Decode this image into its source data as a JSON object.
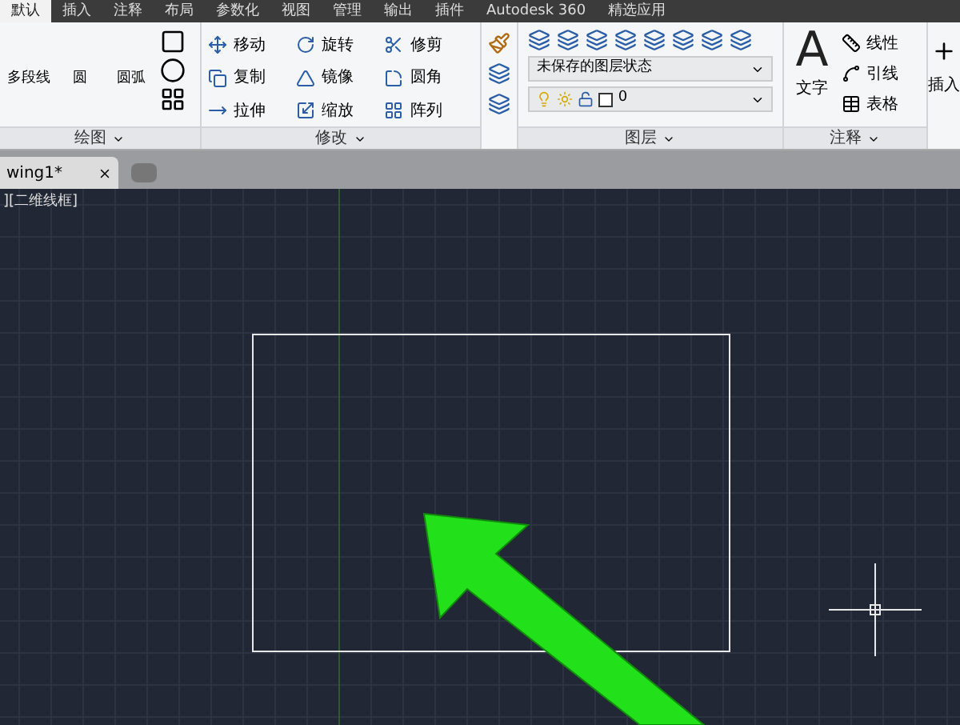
{
  "ribbon_tabs": [
    {
      "label": "默认",
      "selected": true
    },
    {
      "label": "插入",
      "selected": false
    },
    {
      "label": "注释",
      "selected": false
    },
    {
      "label": "布局",
      "selected": false
    },
    {
      "label": "参数化",
      "selected": false
    },
    {
      "label": "视图",
      "selected": false
    },
    {
      "label": "管理",
      "selected": false
    },
    {
      "label": "输出",
      "selected": false
    },
    {
      "label": "插件",
      "selected": false
    },
    {
      "label": "Autodesk 360",
      "selected": false
    },
    {
      "label": "精选应用",
      "selected": false
    }
  ],
  "panels": {
    "draw": {
      "title": "绘图",
      "tools": [
        "多段线",
        "圆",
        "圆弧"
      ]
    },
    "modify": {
      "title": "修改",
      "tools": [
        "移动",
        "旋转",
        "修剪",
        "复制",
        "镜像",
        "圆角",
        "拉伸",
        "缩放",
        "阵列"
      ]
    },
    "layers": {
      "title": "图层",
      "state": "未保存的图层状态",
      "current_layer": "0"
    },
    "annotation": {
      "title": "注释",
      "large_tool": "文字",
      "large_tool_glyph": "A",
      "tools": [
        "线性",
        "引线",
        "表格"
      ]
    },
    "insert": {
      "label": "插入"
    }
  },
  "file_tabs": [
    {
      "label": "wing1*",
      "selected": true
    }
  ],
  "viewport": {
    "label": "][二维线框]"
  }
}
